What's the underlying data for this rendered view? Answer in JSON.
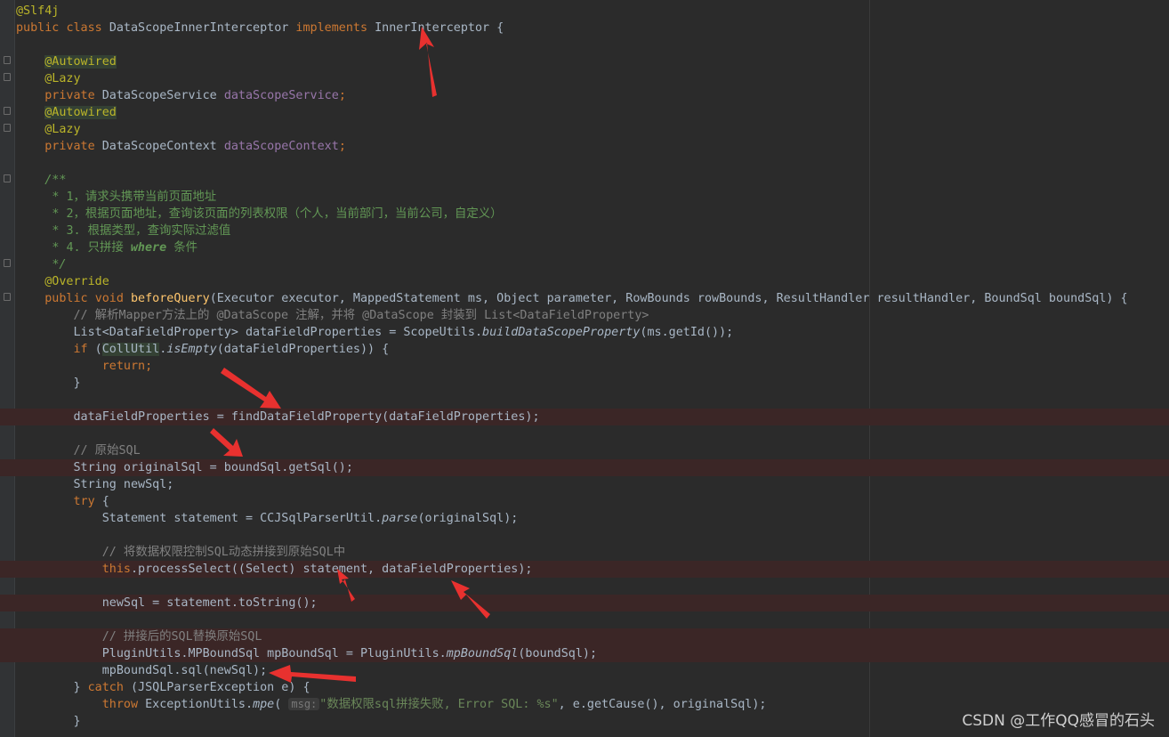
{
  "code": {
    "annotation_slf4j": "@Slf4j",
    "class_decl": {
      "kw_public": "public",
      "kw_class": "class",
      "name": "DataScopeInnerInterceptor",
      "kw_implements": "implements",
      "iface": "InnerInterceptor",
      "brace": "{"
    },
    "autowired": "@Autowired",
    "lazy": "@Lazy",
    "kw_private": "private",
    "service_type": "DataScopeService",
    "service_field": "dataScopeService",
    "context_type": "DataScopeContext",
    "context_field": "dataScopeContext",
    "doc_open": "/**",
    "doc_lines": [
      "1，请求头携带当前页面地址",
      "2，根据页面地址，查询该页面的列表权限（个人，当前部门，当前公司，自定义）",
      "3. 根据类型，查询实际过滤值"
    ],
    "doc_line4_prefix": "4. 只拼接 ",
    "doc_line4_tag": "where",
    "doc_line4_suffix": " 条件",
    "doc_close": "*/",
    "override": "@Override",
    "method": {
      "kw_public": "public",
      "kw_void": "void",
      "name": "beforeQuery",
      "params": "(Executor executor, MappedStatement ms, Object parameter, RowBounds rowBounds, ResultHandler resultHandler, BoundSql boundSql) {"
    },
    "c_parse": "// 解析Mapper方法上的 @DataScope 注解，并将 @DataScope 封装到 List<DataFieldProperty>",
    "l_list_a": "List<DataFieldProperty> dataFieldProperties = ScopeUtils.",
    "l_list_fn": "buildDataScopeProperty",
    "l_list_b": "(ms.getId());",
    "kw_if": "if",
    "l_if_a": " (",
    "l_if_cls": "CollUtil",
    "l_if_dot": ".",
    "l_if_fn": "isEmpty",
    "l_if_b": "(dataFieldProperties)) {",
    "kw_return": "return",
    "semicolon": ";",
    "rbrace": "}",
    "l_find": "dataFieldProperties = findDataFieldProperty(dataFieldProperties);",
    "c_orig": "// 原始SQL",
    "l_orig_sql": "String originalSql = boundSql.getSql();",
    "l_new_sql": "String newSql;",
    "kw_try": "try",
    "brace_open": " {",
    "l_stmt_a": "Statement statement = CCJSqlParserUtil.",
    "l_stmt_fn": "parse",
    "l_stmt_b": "(originalSql);",
    "c_concat": "// 将数据权限控制SQL动态拼接到原始SQL中",
    "kw_this": "this",
    "l_process": ".processSelect((Select) statement, dataFieldProperties);",
    "l_newsql": "newSql = statement.toString();",
    "c_replace": "// 拼接后的SQL替换原始SQL",
    "l_mp_a": "PluginUtils.MPBoundSql mpBoundSql = PluginUtils.",
    "l_mp_fn": "mpBoundSql",
    "l_mp_b": "(boundSql);",
    "l_mpsql": "mpBoundSql.sql(newSql);",
    "kw_catch": "catch",
    "l_catch": " (JSQLParserException e) {",
    "kw_throw": "throw",
    "l_throw_a": " ExceptionUtils.",
    "l_throw_fn": "mpe",
    "l_throw_b": "(",
    "hint_msg": "msg:",
    "l_throw_str": "\"数据权限sql拼接失败, Error SQL: %s\"",
    "l_throw_c": ", e.getCause(), originalSql);"
  },
  "watermark": "CSDN @工作QQ感冒的石头",
  "colors": {
    "background": "#2b2b2b",
    "keyword": "#cc7832",
    "annotation": "#bbb529",
    "field": "#9876aa",
    "method": "#ffc66d",
    "comment": "#808080",
    "doc": "#629755",
    "string": "#6a8759",
    "text": "#a9b7c6",
    "highlight_line": "#3b2626",
    "arrow": "#e8312f"
  }
}
